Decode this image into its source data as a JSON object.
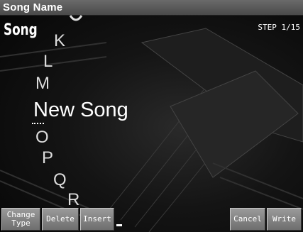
{
  "title_bar": {
    "title": "Song Name"
  },
  "mode_label": "Song",
  "step_indicator": "STEP 1/15",
  "char_list": {
    "above": [
      "K",
      "L",
      "M"
    ],
    "below": [
      "O",
      "P",
      "Q",
      "R"
    ]
  },
  "name_value": "New Song",
  "buttons": {
    "change_type_line1": "Change",
    "change_type_line2": "Type",
    "delete": "Delete",
    "insert": "Insert",
    "cancel": "Cancel",
    "write": "Write"
  }
}
